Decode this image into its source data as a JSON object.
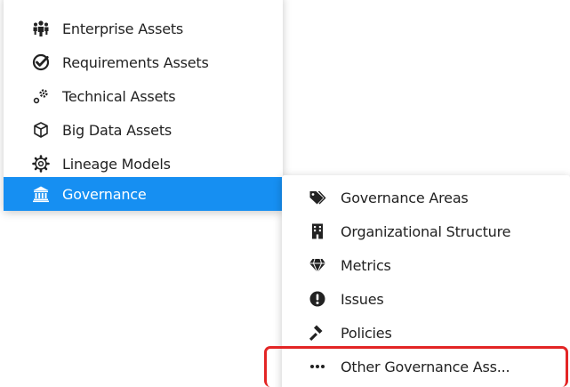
{
  "main_menu": {
    "items": [
      {
        "label": "Enterprise Assets",
        "icon": "users-group-icon",
        "active": false
      },
      {
        "label": "Requirements Assets",
        "icon": "check-badge-icon",
        "active": false
      },
      {
        "label": "Technical Assets",
        "icon": "cogs-icon",
        "active": false
      },
      {
        "label": "Big Data Assets",
        "icon": "cube-icon",
        "active": false
      },
      {
        "label": "Lineage Models",
        "icon": "gear-outline-icon",
        "active": false
      },
      {
        "label": "Governance",
        "icon": "bank-icon",
        "active": true
      }
    ]
  },
  "governance_submenu": {
    "items": [
      {
        "label": "Governance Areas",
        "icon": "tags-icon"
      },
      {
        "label": "Organizational Structure",
        "icon": "building-icon"
      },
      {
        "label": "Metrics",
        "icon": "diamond-icon"
      },
      {
        "label": "Issues",
        "icon": "exclamation-circle-icon"
      },
      {
        "label": "Policies",
        "icon": "gavel-icon"
      },
      {
        "label": "Other Governance Ass...",
        "icon": "ellipsis-icon"
      }
    ]
  },
  "colors": {
    "active_bg": "#168ff2",
    "highlight": "#e32525",
    "text": "#222222"
  }
}
